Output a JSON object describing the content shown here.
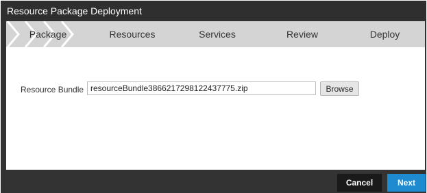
{
  "window": {
    "title": "Resource Package Deployment"
  },
  "wizard": {
    "steps": [
      {
        "label": "Package"
      },
      {
        "label": "Resources"
      },
      {
        "label": "Services"
      },
      {
        "label": "Review"
      },
      {
        "label": "Deploy"
      }
    ]
  },
  "form": {
    "resource_bundle_label": "Resource Bundle",
    "resource_bundle_value": "resourceBundle3866217298122437775.zip",
    "browse_label": "Browse"
  },
  "footer": {
    "cancel_label": "Cancel",
    "next_label": "Next"
  },
  "colors": {
    "accent": "#1e8bd0",
    "title_bar": "#2f2f2f",
    "steps_bar": "#d4d4d4",
    "step_separator": "#ffffff"
  }
}
